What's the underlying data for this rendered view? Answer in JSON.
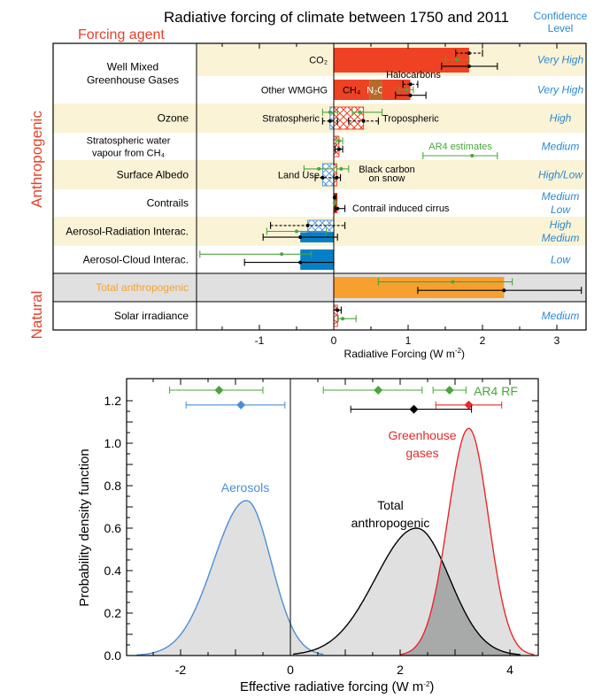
{
  "chart_data": [
    {
      "type": "bar",
      "title": "Radiative forcing of climate between 1750 and 2011",
      "left_header": "Forcing agent",
      "right_header": [
        "Confidence",
        "Level"
      ],
      "xlabel": "Radiative Forcing (W m",
      "xlabel_sup": "-2",
      "xlabel_end": ")",
      "xlim": [
        -1.85,
        3.4
      ],
      "xticks": [
        -1,
        0,
        1,
        2,
        3
      ],
      "group_labels": [
        {
          "text": "Anthropogenic",
          "color": "#e8402a"
        },
        {
          "text": "Natural",
          "color": "#e8402a"
        }
      ],
      "colors": {
        "erf": "#000000",
        "ar4": "#4aa53a",
        "co2": "#ef4123",
        "n2o": "#b86a2a",
        "blue": "#0580c8",
        "orange": "#f7a030",
        "confidence": "#2a8ad0",
        "shade": "#fbf3d6",
        "gray": "#e0e0e0"
      },
      "categories": [
        {
          "label": [
            "Well Mixed",
            "Greenhouse Gases"
          ],
          "rows": [
            0,
            1
          ]
        },
        {
          "label": [
            "Ozone"
          ],
          "rows": [
            2
          ]
        },
        {
          "label": [
            "Stratospheric water",
            "vapour from CH₄"
          ],
          "rows": [
            3
          ]
        },
        {
          "label": [
            "Surface Albedo"
          ],
          "rows": [
            4
          ]
        },
        {
          "label": [
            "Contrails"
          ],
          "rows": [
            5
          ]
        },
        {
          "label": [
            "Aerosol-Radiation Interac."
          ],
          "rows": [
            6
          ]
        },
        {
          "label": [
            "Aerosol-Cloud Interac."
          ],
          "rows": [
            7
          ]
        },
        {
          "label": [
            "Total anthropogenic"
          ],
          "rows": [
            8
          ],
          "color": "#f7a030"
        },
        {
          "label": [
            "Solar irradiance"
          ],
          "rows": [
            9
          ]
        }
      ],
      "rows": [
        {
          "sublabel": "CO₂",
          "confidence": [
            "Very High"
          ],
          "shaded": "beige",
          "bars": [
            {
              "from": 0,
              "to": 1.82,
              "color": "#ef4123"
            }
          ],
          "errorbars": [
            {
              "kind": "rf",
              "center": 1.82,
              "low": 1.64,
              "high": 2.0
            },
            {
              "kind": "ar4",
              "center": 1.66,
              "low": 1.5,
              "high": 1.82
            },
            {
              "kind": "erf",
              "center": 1.82,
              "low": 1.45,
              "high": 2.2
            }
          ]
        },
        {
          "sublabel": "Other WMGHG",
          "confidence": [
            "Very High"
          ],
          "shaded": "none",
          "bars": [
            {
              "from": 0,
              "to": 0.48,
              "color": "#ef4123",
              "text": "CH₄"
            },
            {
              "from": 0.48,
              "to": 0.65,
              "color": "#b86a2a",
              "text": "N₂O"
            },
            {
              "from": 0.65,
              "to": 1.03,
              "color": "#ef4123",
              "text": "Halocarbons"
            }
          ],
          "errorbars": [
            {
              "kind": "rf",
              "center": 1.03,
              "low": 0.93,
              "high": 1.13
            },
            {
              "kind": "ar4",
              "center": 0.98,
              "low": 0.88,
              "high": 1.07
            },
            {
              "kind": "erf",
              "center": 1.03,
              "low": 0.83,
              "high": 1.24
            }
          ]
        },
        {
          "sublabel": "Stratospheric",
          "sublabel_right": "Tropospheric",
          "confidence": [
            "High"
          ],
          "shaded": "beige",
          "bars": [
            {
              "from": -0.05,
              "to": 0,
              "color": "#5a9ad8",
              "hatched": true
            },
            {
              "from": 0,
              "to": 0.4,
              "color": "#ef4123",
              "hatched": true
            }
          ],
          "errorbars": [
            {
              "kind": "ar4",
              "center": -0.05,
              "low": -0.15,
              "high": 0.05
            },
            {
              "kind": "ar4",
              "center": 0.35,
              "low": 0.25,
              "high": 0.65
            },
            {
              "kind": "rf",
              "center": -0.05,
              "low": -0.15,
              "high": 0.05
            },
            {
              "kind": "rf",
              "center": 0.4,
              "low": 0.2,
              "high": 0.6
            }
          ]
        },
        {
          "confidence": [
            "Medium"
          ],
          "shaded": "none",
          "bars": [
            {
              "from": 0,
              "to": 0.07,
              "color": "#ef4123",
              "hatched": true
            }
          ],
          "errorbars": [
            {
              "kind": "ar4",
              "center": 0.07,
              "low": 0.03,
              "high": 0.12
            },
            {
              "kind": "rf",
              "center": 0.07,
              "low": 0.02,
              "high": 0.12
            }
          ],
          "legend": {
            "text": "AR4 estimates",
            "center": 1.86,
            "low": 1.2,
            "high": 2.2
          }
        },
        {
          "sublabel": "Land Use",
          "sublabel_right": [
            "Black carbon",
            "on snow"
          ],
          "confidence": [
            "High/Low"
          ],
          "shaded": "beige",
          "bars": [
            {
              "from": -0.15,
              "to": 0,
              "color": "#5a9ad8",
              "hatched": true
            },
            {
              "from": 0,
              "to": 0.04,
              "color": "#ef4123",
              "hatched": true
            }
          ],
          "errorbars": [
            {
              "kind": "ar4",
              "center": -0.2,
              "low": -0.4,
              "high": 0
            },
            {
              "kind": "ar4",
              "center": 0.1,
              "low": 0.04,
              "high": 0.2
            },
            {
              "kind": "rf",
              "center": -0.15,
              "low": -0.25,
              "high": 0
            },
            {
              "kind": "rf",
              "center": 0.04,
              "low": 0,
              "high": 0.09
            }
          ]
        },
        {
          "sublabel_right": "Contrail induced cirrus",
          "confidence": [
            "Medium",
            "Low"
          ],
          "shaded": "none",
          "bars": [
            {
              "from": 0,
              "to": 0.05,
              "color": "#ef4123"
            }
          ],
          "errorbars": [
            {
              "kind": "rf",
              "center": 0.01,
              "low": 0.005,
              "high": 0.03
            },
            {
              "kind": "ar4",
              "center": 0.01,
              "low": 0.003,
              "high": 0.03
            },
            {
              "kind": "erf",
              "center": 0.05,
              "low": 0.02,
              "high": 0.15
            }
          ]
        },
        {
          "confidence": [
            "High",
            "Medium"
          ],
          "shaded": "beige",
          "bars": [
            {
              "from": -0.35,
              "to": 0,
              "color": "#5a9ad8",
              "hatched": true,
              "half": "top"
            },
            {
              "from": -0.45,
              "to": 0,
              "color": "#0580c8",
              "half": "bottom"
            }
          ],
          "errorbars": [
            {
              "kind": "rf",
              "center": -0.35,
              "low": -0.85,
              "high": 0.15
            },
            {
              "kind": "ar4",
              "center": -0.5,
              "low": -0.9,
              "high": -0.1
            },
            {
              "kind": "erf",
              "center": -0.45,
              "low": -0.95,
              "high": 0.05
            }
          ]
        },
        {
          "confidence": [
            "Low"
          ],
          "shaded": "none",
          "bars": [
            {
              "from": -0.45,
              "to": 0,
              "color": "#0580c8"
            }
          ],
          "errorbars": [
            {
              "kind": "ar4",
              "center": -0.7,
              "low": -1.8,
              "high": -0.3
            },
            {
              "kind": "erf",
              "center": -0.45,
              "low": -1.2,
              "high": 0
            }
          ]
        },
        {
          "confidence": [],
          "shaded": "gray",
          "bars": [
            {
              "from": 0,
              "to": 2.29,
              "color": "#f7a030"
            }
          ],
          "errorbars": [
            {
              "kind": "ar4",
              "center": 1.6,
              "low": 0.6,
              "high": 2.4
            },
            {
              "kind": "erf",
              "center": 2.29,
              "low": 1.13,
              "high": 3.33
            }
          ]
        },
        {
          "confidence": [
            "Medium"
          ],
          "shaded": "none",
          "bars": [
            {
              "from": 0,
              "to": 0.05,
              "color": "#ef4123",
              "hatched": true
            }
          ],
          "errorbars": [
            {
              "kind": "ar4",
              "center": 0.12,
              "low": 0.06,
              "high": 0.3
            },
            {
              "kind": "rf",
              "center": 0.05,
              "low": 0,
              "high": 0.1
            }
          ]
        }
      ]
    },
    {
      "type": "area",
      "xlabel": "Effective radiative forcing (W m",
      "xlabel_sup": "-2",
      "xlabel_end": ")",
      "ylabel": "Probability density function",
      "xlim": [
        -3.0,
        4.5
      ],
      "ylim": [
        0,
        1.3
      ],
      "xticks": [
        -2,
        0,
        2,
        4
      ],
      "yticks": [
        "0.0",
        "0.2",
        "0.4",
        "0.6",
        "0.8",
        "1.0",
        "1.2"
      ],
      "series": [
        {
          "name": "Aerosols",
          "color": "#4a8fd6",
          "mode": -0.8,
          "peak": 0.73,
          "sd_left": 0.6,
          "sd_right": 0.45,
          "range": [
            -2.8,
            0.6
          ]
        },
        {
          "name": "Total anthropogenic",
          "label": [
            "Total",
            "anthropogenic"
          ],
          "color": "#000000",
          "mode": 2.3,
          "peak": 0.6,
          "sd_left": 0.75,
          "sd_right": 0.6,
          "range": [
            0.05,
            4.2
          ]
        },
        {
          "name": "Greenhouse gases",
          "label": [
            "Greenhouse",
            "gases"
          ],
          "color": "#e8282a",
          "mode": 3.25,
          "peak": 1.07,
          "sd_left": 0.38,
          "sd_right": 0.36,
          "range": [
            2.0,
            4.45
          ]
        }
      ],
      "ranges": [
        {
          "color": "#4aa53a",
          "y": 1.25,
          "center": -1.3,
          "low": -2.2,
          "high": -0.5
        },
        {
          "color": "#4a8fd6",
          "y": 1.18,
          "center": -0.9,
          "low": -1.9,
          "high": -0.1
        },
        {
          "color": "#4aa53a",
          "y": 1.25,
          "center": 1.6,
          "low": 0.6,
          "high": 2.4
        },
        {
          "color": "#4aa53a",
          "y": 1.25,
          "center": 2.9,
          "low": 2.6,
          "high": 3.2
        },
        {
          "color": "#e8282a",
          "y": 1.18,
          "center": 3.25,
          "low": 2.65,
          "high": 3.85
        },
        {
          "color": "#000000",
          "y": 1.16,
          "center": 2.25,
          "low": 1.1,
          "high": 3.3
        }
      ],
      "legend_label": {
        "text": "AR4 RF",
        "color": "#4aa53a"
      }
    }
  ]
}
